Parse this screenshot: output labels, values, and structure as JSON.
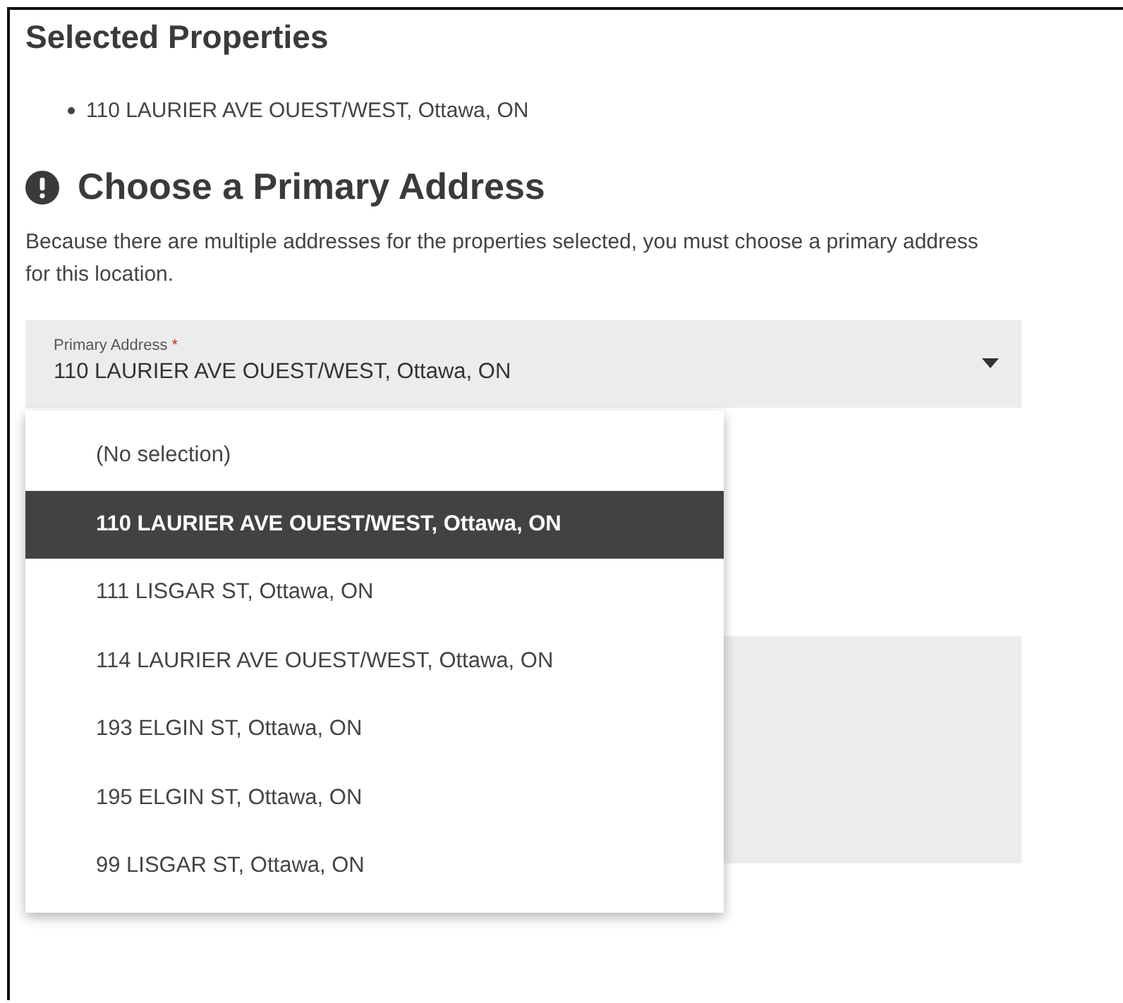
{
  "selected_properties": {
    "title": "Selected Properties",
    "items": [
      "110 LAURIER AVE OUEST/WEST, Ottawa, ON"
    ]
  },
  "primary_address": {
    "title": "Choose a Primary Address",
    "description": "Because there are multiple addresses for the properties selected, you must choose a primary address for this location.",
    "field": {
      "label": "Primary Address",
      "required_mark": "*",
      "value": "110 LAURIER AVE OUEST/WEST, Ottawa, ON",
      "expanded": true
    },
    "options": [
      {
        "label": "(No selection)",
        "selected": false
      },
      {
        "label": "110 LAURIER AVE OUEST/WEST, Ottawa, ON",
        "selected": true
      },
      {
        "label": "111 LISGAR ST, Ottawa, ON",
        "selected": false
      },
      {
        "label": "114 LAURIER AVE OUEST/WEST, Ottawa, ON",
        "selected": false
      },
      {
        "label": "193 ELGIN ST, Ottawa, ON",
        "selected": false
      },
      {
        "label": "195 ELGIN ST, Ottawa, ON",
        "selected": false
      },
      {
        "label": "99 LISGAR ST, Ottawa, ON",
        "selected": false
      }
    ]
  }
}
